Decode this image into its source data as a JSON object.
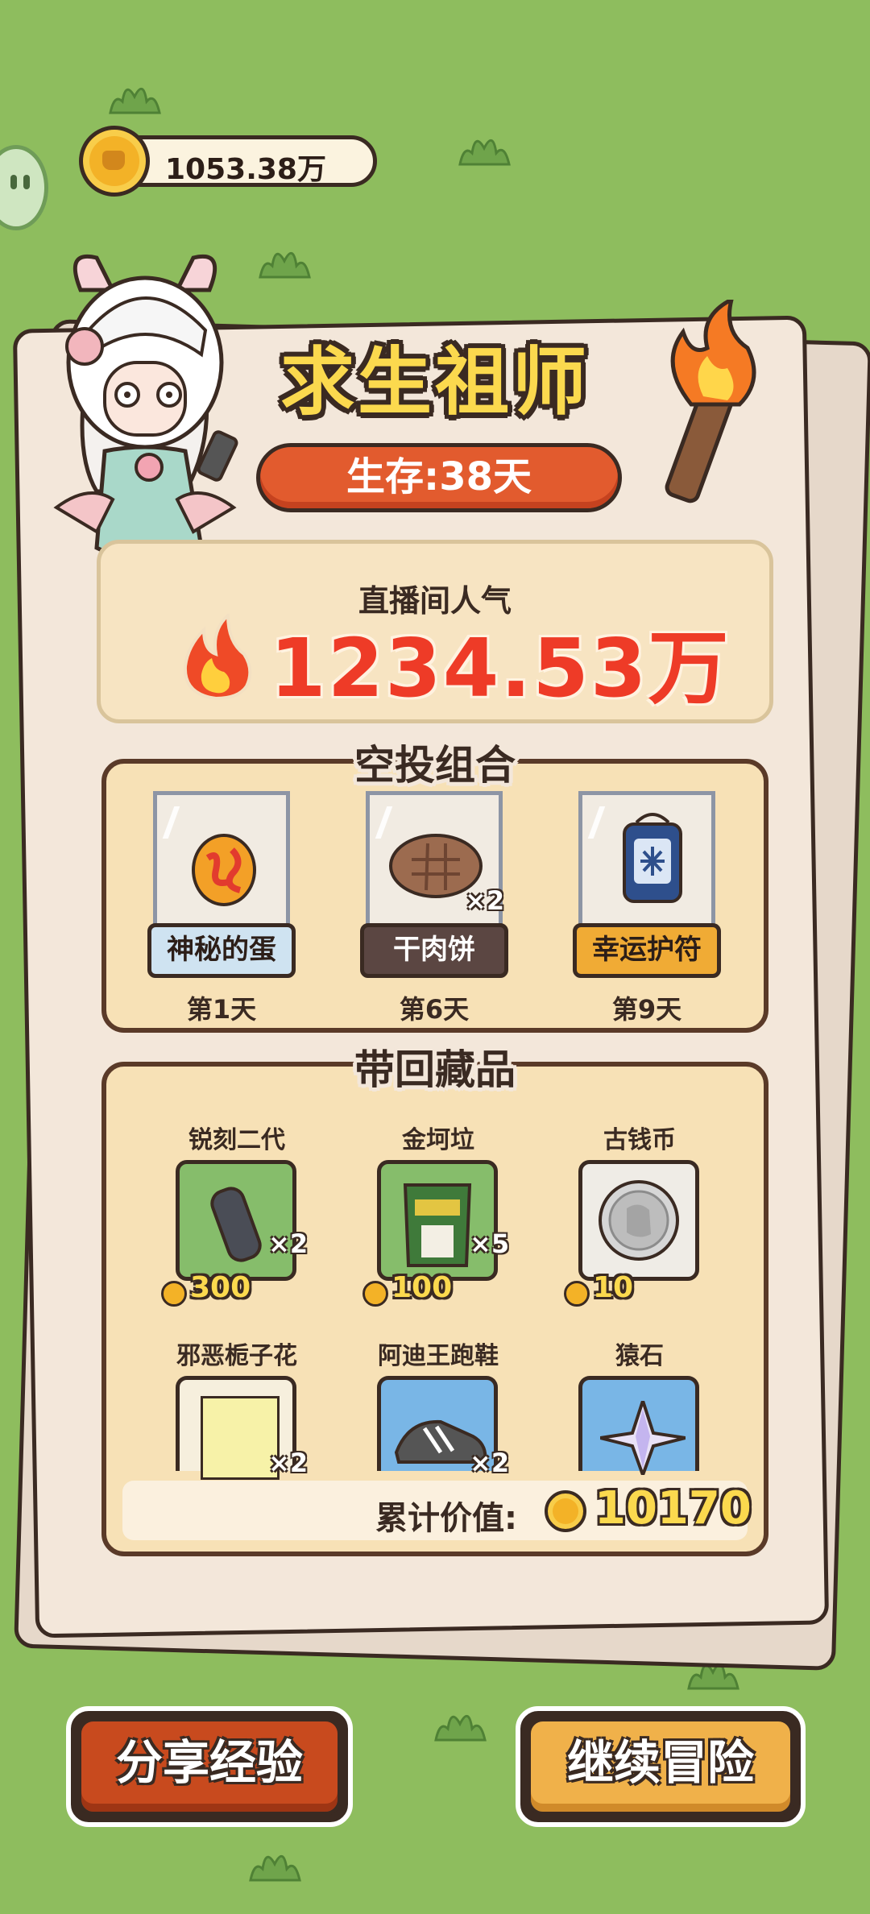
{
  "currency": {
    "amount": "1053.38万"
  },
  "header": {
    "title": "求生祖师",
    "survival": "生存:38天"
  },
  "popularity": {
    "label": "直播间人气",
    "value": "1234.53万"
  },
  "airdrop": {
    "title": "空投组合",
    "items": [
      {
        "name": "神秘的蛋",
        "day": "第1天",
        "qty": "",
        "label_color": "#cfe3f1",
        "label_text_color": "#2c1e18"
      },
      {
        "name": "干肉饼",
        "day": "第6天",
        "qty": "×2",
        "label_color": "#5b4642",
        "label_text_color": "#ffffff"
      },
      {
        "name": "幸运护符",
        "day": "第9天",
        "qty": "",
        "label_color": "#f0ab35",
        "label_text_color": "#2c1e18"
      }
    ]
  },
  "collection": {
    "title": "带回藏品",
    "items": [
      {
        "name": "锐刻二代",
        "qty": "×2",
        "price": "300"
      },
      {
        "name": "金坷垃",
        "qty": "×5",
        "price": "100"
      },
      {
        "name": "古钱币",
        "qty": "",
        "price": "10"
      },
      {
        "name": "邪恶栀子花",
        "qty": "×2",
        "price": ""
      },
      {
        "name": "阿迪王跑鞋",
        "qty": "×2",
        "price": ""
      },
      {
        "name": "猿石",
        "qty": "",
        "price": ""
      }
    ],
    "total_label": "累计价值:",
    "total_value": "10170"
  },
  "buttons": {
    "share": "分享经验",
    "continue": "继续冒险"
  },
  "colors": {
    "background": "#8ebd5e",
    "accent_orange": "#e25b2e",
    "popularity_red": "#ee3b27",
    "gold": "#fbd94e"
  }
}
